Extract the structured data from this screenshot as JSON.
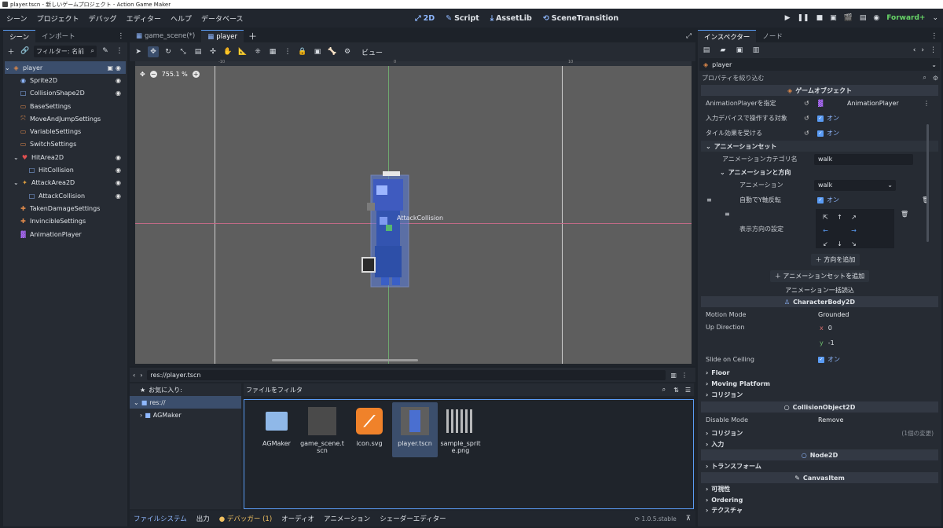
{
  "window_title": "player.tscn - 新しいゲームプロジェクト - Action Game Maker",
  "menu": [
    "シーン",
    "プロジェクト",
    "デバッグ",
    "エディター",
    "ヘルプ",
    "データベース"
  ],
  "workspaces": [
    {
      "icon": "2d-icon",
      "label": "2D"
    },
    {
      "icon": "script-icon",
      "label": "Script"
    },
    {
      "icon": "assetlib-icon",
      "label": "AssetLib"
    },
    {
      "icon": "scene-transition-icon",
      "label": "SceneTransition"
    }
  ],
  "renderer": "Forward+",
  "scene_dock": {
    "tabs": [
      "シーン",
      "インポート"
    ],
    "filter_placeholder": "フィルター: 名前",
    "nodes": [
      {
        "name": "player",
        "depth": 0,
        "icon": "gameobject-icon",
        "selected": true,
        "eye": true
      },
      {
        "name": "Sprite2D",
        "depth": 1,
        "icon": "sprite-icon",
        "eye": true
      },
      {
        "name": "CollisionShape2D",
        "depth": 1,
        "icon": "collision-shape-icon",
        "eye": true
      },
      {
        "name": "BaseSettings",
        "depth": 1,
        "icon": "settings-icon",
        "eye": false
      },
      {
        "name": "MoveAndJumpSettings",
        "depth": 1,
        "icon": "move-icon",
        "eye": false
      },
      {
        "name": "VariableSettings",
        "depth": 1,
        "icon": "variable-icon",
        "eye": false
      },
      {
        "name": "SwitchSettings",
        "depth": 1,
        "icon": "switch-icon",
        "eye": false
      },
      {
        "name": "HitArea2D",
        "depth": 1,
        "icon": "hitarea-icon",
        "eye": true
      },
      {
        "name": "HitCollision",
        "depth": 2,
        "icon": "collision-shape-icon",
        "eye": true
      },
      {
        "name": "AttackArea2D",
        "depth": 1,
        "icon": "attackarea-icon",
        "eye": true
      },
      {
        "name": "AttackCollision",
        "depth": 2,
        "icon": "collision-shape-icon",
        "eye": true
      },
      {
        "name": "TakenDamageSettings",
        "depth": 1,
        "icon": "damage-icon",
        "eye": false
      },
      {
        "name": "InvincibleSettings",
        "depth": 1,
        "icon": "invincible-icon",
        "eye": false
      },
      {
        "name": "AnimationPlayer",
        "depth": 1,
        "icon": "animation-player-icon",
        "eye": false
      }
    ]
  },
  "editor_tabs": [
    "game_scene(*)",
    "player"
  ],
  "toolbar": {
    "view_label": "ビュー"
  },
  "viewport": {
    "zoom": "755.1 %",
    "ruler_marks": [
      "-10",
      "0",
      "10"
    ],
    "collision_label": "AttackCollision"
  },
  "filesystem": {
    "path": "res://player.tscn",
    "favorites": "お気に入り:",
    "filter_placeholder": "ファイルをフィルタ",
    "tree": [
      "res://",
      "AGMaker"
    ],
    "files": [
      {
        "name": "AGMaker",
        "type": "folder"
      },
      {
        "name": "game_scene.tscn",
        "type": "scene"
      },
      {
        "name": "icon.svg",
        "type": "svg"
      },
      {
        "name": "player.tscn",
        "type": "player"
      },
      {
        "name": "sample_sprite.png",
        "type": "sprites"
      }
    ]
  },
  "bottom_tabs": [
    "ファイルシステム",
    "出力",
    "デバッガー (1)",
    "オーディオ",
    "アニメーション",
    "シェーダーエディター"
  ],
  "version": "1.0.5.stable",
  "inspector": {
    "tabs": [
      "インスペクター",
      "ノード"
    ],
    "node_name": "player",
    "filter_placeholder": "プロパティを絞り込む",
    "section_gameobject": "ゲームオブジェクト",
    "animplayer_label": "AnimationPlayerを指定",
    "animplayer_value": "AnimationPlayer",
    "input_label": "入力デバイスで操作する対象",
    "tile_label": "タイル効果を受ける",
    "on": "オン",
    "animset_header": "アニメーションセット",
    "anim_category_label": "アニメーションカテゴリ名",
    "anim_category_value": "walk",
    "anim_dir_header": "アニメーションと方向",
    "anim_label": "アニメーション",
    "anim_value": "walk",
    "auto_flip_label": "自動でY軸反転",
    "direction_label": "表示方向の設定",
    "add_direction": "方向を追加",
    "add_animset": "アニメーションセットを追加",
    "bulk_load": "アニメーション一括読込",
    "section_characterbody": "CharacterBody2D",
    "motion_mode_label": "Motion Mode",
    "motion_mode_value": "Grounded",
    "up_direction_label": "Up Direction",
    "up_x": "0",
    "up_y": "-1",
    "slide_label": "Slide on Ceiling",
    "floor": "Floor",
    "moving_platform": "Moving Platform",
    "collision": "コリジョン",
    "section_collisionobject": "CollisionObject2D",
    "disable_mode_label": "Disable Mode",
    "disable_mode_value": "Remove",
    "collision2": "コリジョン",
    "collision2_note": "(1個の変更)",
    "input": "入力",
    "section_node2d": "Node2D",
    "transform": "トランスフォーム",
    "section_canvasitem": "CanvasItem",
    "visibility": "可視性",
    "ordering": "Ordering",
    "texture": "テクスチャ"
  },
  "colors": {
    "accent": "#5a9cf5",
    "renderer": "#67d567",
    "selection": "#3b4e6c"
  }
}
